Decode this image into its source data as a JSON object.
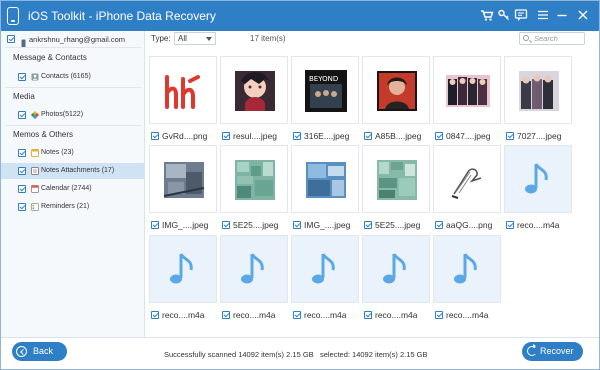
{
  "app": {
    "title": "iOS Toolkit - iPhone Data Recovery",
    "title_icons": [
      "cart-icon",
      "key-icon",
      "feedback-icon",
      "menu-icon",
      "minimize-icon",
      "close-icon"
    ]
  },
  "sidebar": {
    "account": "ankrshnu_rhang@gmail.com",
    "sections": [
      {
        "title": "Message & Contacts",
        "items": [
          {
            "label": "Contacts (6165)",
            "icon": "contacts-icon"
          }
        ]
      },
      {
        "title": "Media",
        "items": [
          {
            "label": "Photos(5122)",
            "icon": "photos-icon"
          }
        ]
      },
      {
        "title": "Memos & Others",
        "items": [
          {
            "label": "Notes (23)",
            "icon": "notes-icon"
          },
          {
            "label": "Notes Attachments (17)",
            "icon": "notes-attachments-icon",
            "selected": true
          },
          {
            "label": "Calendar (2744)",
            "icon": "calendar-icon"
          },
          {
            "label": "Reminders (21)",
            "icon": "reminders-icon"
          }
        ]
      }
    ]
  },
  "toolbar": {
    "type_label": "Type:",
    "type_value": "All",
    "count_label": "17 item(s)",
    "search_placeholder": "Search"
  },
  "files": [
    {
      "name": "GvRd....png",
      "kind": "image"
    },
    {
      "name": "resul....jpeg",
      "kind": "image"
    },
    {
      "name": "316E....jpeg",
      "kind": "image"
    },
    {
      "name": "A85B....jpeg",
      "kind": "image"
    },
    {
      "name": "0847....jpeg",
      "kind": "image"
    },
    {
      "name": "7027....jpeg",
      "kind": "image"
    },
    {
      "name": "IMG_....jpeg",
      "kind": "image"
    },
    {
      "name": "5E25....jpeg",
      "kind": "image"
    },
    {
      "name": "IMG_....jpeg",
      "kind": "image"
    },
    {
      "name": "5E25....jpeg",
      "kind": "image"
    },
    {
      "name": "aaQG....png",
      "kind": "image"
    },
    {
      "name": "reco....m4a",
      "kind": "audio"
    },
    {
      "name": "reco....m4a",
      "kind": "audio"
    },
    {
      "name": "reco....m4a",
      "kind": "audio"
    },
    {
      "name": "reco....m4a",
      "kind": "audio"
    },
    {
      "name": "reco....m4a",
      "kind": "audio"
    },
    {
      "name": "reco....m4a",
      "kind": "audio"
    }
  ],
  "footer": {
    "back_label": "Back",
    "scan_status": "Successfully scanned 14092 item(s) 2.15 GB",
    "selected_status": "selected: 14092 item(s) 2.15 GB",
    "recover_label": "Recover"
  },
  "colors": {
    "accent": "#2f7fc7",
    "selected_row": "#cfe3f5",
    "audio_note": "#5aa9e6"
  }
}
